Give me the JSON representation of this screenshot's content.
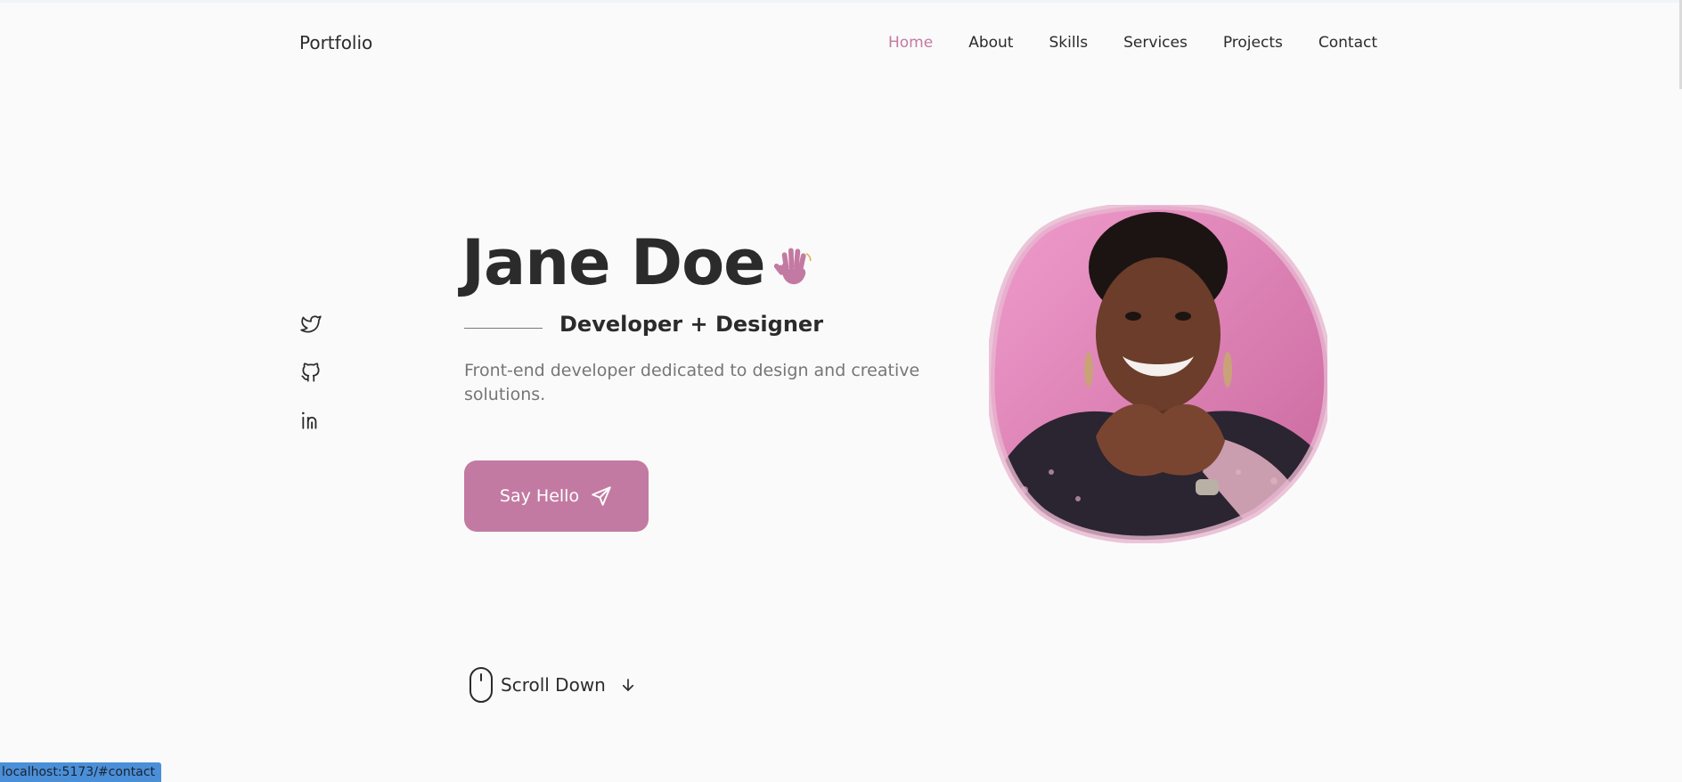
{
  "header": {
    "logo": "Portfolio",
    "nav": [
      {
        "label": "Home",
        "active": true
      },
      {
        "label": "About",
        "active": false
      },
      {
        "label": "Skills",
        "active": false
      },
      {
        "label": "Services",
        "active": false
      },
      {
        "label": "Projects",
        "active": false
      },
      {
        "label": "Contact",
        "active": false
      }
    ]
  },
  "socials": [
    {
      "icon": "twitter-icon"
    },
    {
      "icon": "github-icon"
    },
    {
      "icon": "linkedin-icon"
    }
  ],
  "hero": {
    "name": "Jane Doe",
    "wave_icon": "waving-hand-icon",
    "subtitle": "Developer + Designer",
    "description": "Front-end developer dedicated to design and creative solutions.",
    "cta_label": "Say Hello",
    "cta_icon": "send-icon"
  },
  "scroll": {
    "label": "Scroll Down",
    "mouse_icon": "mouse-icon",
    "arrow_icon": "arrow-down-icon"
  },
  "status_bar": {
    "url": "localhost:5173/#contact"
  },
  "colors": {
    "accent": "#c37aa2",
    "text": "#2b2b2b",
    "muted": "#767676",
    "background": "#fafafa"
  }
}
